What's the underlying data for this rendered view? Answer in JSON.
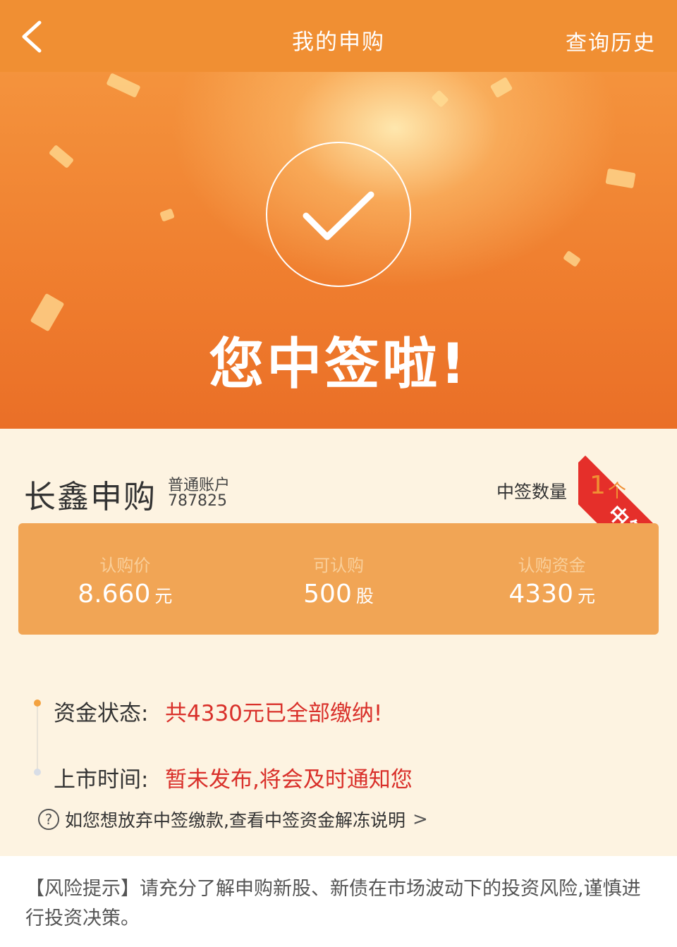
{
  "header": {
    "title": "我的申购",
    "history_label": "查询历史",
    "back_icon": "chevron-left-icon"
  },
  "hero": {
    "check_icon": "check-circle-icon",
    "message": "您中签啦!"
  },
  "ribbon": {
    "label": "中签"
  },
  "stock": {
    "name": "长鑫申购",
    "account_type": "普通账户",
    "account_no": "787825",
    "win_qty_label": "中签数量",
    "win_qty_value": "1",
    "win_qty_unit": "个"
  },
  "info": [
    {
      "label": "认购价",
      "value": "8.660",
      "unit": "元"
    },
    {
      "label": "可认购",
      "value": "500",
      "unit": "股"
    },
    {
      "label": "认购资金",
      "value": "4330",
      "unit": "元"
    }
  ],
  "status": {
    "fund_label": "资金状态:",
    "fund_value": "共4330元已全部缴纳!",
    "listing_label": "上市时间:",
    "listing_value": "暂未发布,将会及时通知您"
  },
  "help": {
    "icon": "question-circle-icon",
    "text": "如您想放弃中签缴款,查看中签资金解冻说明",
    "chevron": ">"
  },
  "risk": {
    "text": "【风险提示】请充分了解申购新股、新债在市场波动下的投资风险,谨慎进行投资决策。"
  },
  "colors": {
    "brand_orange": "#f08f33",
    "card_orange": "#f1a555",
    "alert_red": "#d9302a",
    "ribbon_red": "#e52f2a"
  }
}
